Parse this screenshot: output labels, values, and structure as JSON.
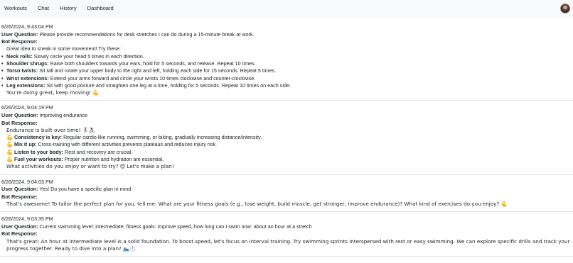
{
  "nav": {
    "links": [
      "Workouts",
      "Chat",
      "History",
      "Dashboard"
    ]
  },
  "labels": {
    "user_question": "User Question:",
    "bot_response": "Bot Response:"
  },
  "entries": [
    {
      "timestamp": "6/26/2024, 9:43:04 PM",
      "question": "Please provide recommendations for desk stretches I can do during a 15-minute break at work.",
      "intro": "Great idea to sneak in some movement! Try these:",
      "bullets": [
        {
          "title": "Neck rolls:",
          "text": "Slowly circle your head 5 times in each direction."
        },
        {
          "title": "Shoulder shrugs:",
          "text": "Raise both shoulders towards your ears, hold for 5 seconds, and release. Repeat 10 times."
        },
        {
          "title": "Torso twists:",
          "text": "Sit tall and rotate your upper body to the right and left, holding each side for 15 seconds. Repeat 5 times."
        },
        {
          "title": "Wrist extensions:",
          "text": "Extend your arms forward and circle your wrists 10 times clockwise and counter-clockwise."
        },
        {
          "title": "Leg extensions:",
          "text": "Sit with good posture and straighten one leg at a time, holding for 5 seconds. Repeat 10 times on each side."
        }
      ],
      "outro": "You're doing great, keep moving! 💪"
    },
    {
      "timestamp": "6/26/2024, 9:04:19 PM",
      "question": "Improving endurance",
      "intro": "Endurance is built over time! 🏃‍♀️🚴‍♀️",
      "points": [
        {
          "icon": "💪",
          "title": "Consistency is key:",
          "text": "Regular cardio like running, swimming, or biking, gradually increasing distance/intensity."
        },
        {
          "icon": "💪",
          "title": "Mix it up:",
          "text": "Cross-training with different activities prevents plateaus and reduces injury risk."
        },
        {
          "icon": "💪",
          "title": "Listen to your body:",
          "text": "Rest and recovery are crucial."
        },
        {
          "icon": "💪",
          "title": "Fuel your workouts:",
          "text": "Proper nutrition and hydration are essential."
        }
      ],
      "outro": "What activities do you enjoy or want to try? 😊 Let's make a plan!"
    },
    {
      "timestamp": "6/26/2024, 9:04:03 PM",
      "question": "Yes! Do you have a specific plan in mind",
      "response": "That's awesome! To tailor the perfect plan for you, tell me: What are your fitness goals (e.g., lose weight, build muscle, get stronger, improve endurance)? What kind of exercises do you enjoy? 💪"
    },
    {
      "timestamp": "6/26/2024, 9:03:35 PM",
      "question": "Current swimming level: intermediate, fitness goals: improve speed, how long can I swim now: about an hour at a stretch",
      "response": "That's great! An hour at intermediate level is a solid foundation. To boost speed, let's focus on interval training. Try swimming sprints interspersed with rest or easy swimming. We can explore specific drills and track your progress together. Ready to dive into a plan? 🏊‍♀️⏱️"
    }
  ]
}
